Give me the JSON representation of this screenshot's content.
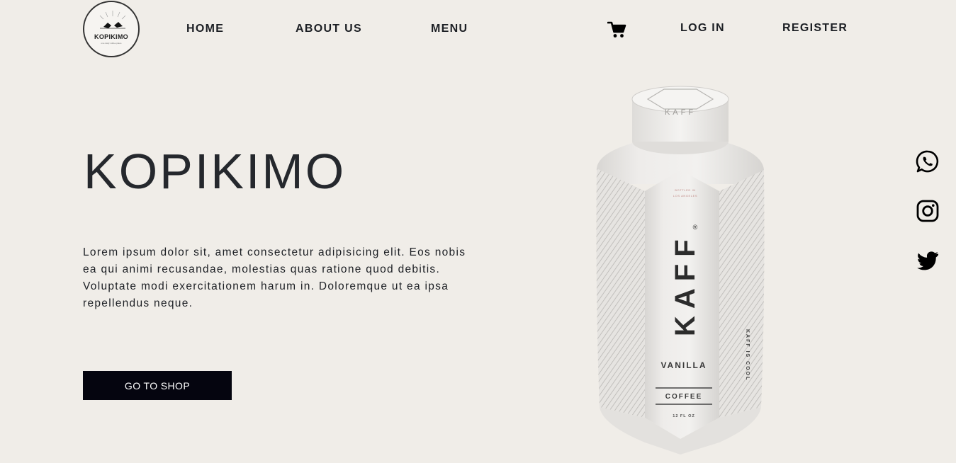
{
  "brand": {
    "logo_text": "KOPIKIMO",
    "logo_subtext": "one daily coffee place"
  },
  "nav": {
    "home": "HOME",
    "about": "ABOUT US",
    "menu": "MENU",
    "login": "LOG IN",
    "register": "REGISTER",
    "cart_icon": "shopping-cart-icon"
  },
  "hero": {
    "title": "KOPIKIMO",
    "description": "Lorem ipsum dolor sit, amet consectetur adipisicing elit. Eos nobis ea qui animi recusandae, molestias quas ratione quod debitis. Voluptate modi exercitationem harum in. Doloremque ut ea ipsa repellendus neque.",
    "cta_label": "GO TO SHOP"
  },
  "product": {
    "cap_text": "KAFF",
    "tagline_1": "BOTTLED IN",
    "tagline_2": "LOS ANGELES",
    "brand_vertical": "KAFF",
    "registered_mark": "®",
    "flavor": "VANILLA",
    "type": "COFFEE",
    "volume": "12 FL OZ",
    "side_text": "KAFF IS COOL"
  },
  "social": {
    "icons": [
      "whatsapp-icon",
      "instagram-icon",
      "twitter-icon"
    ]
  },
  "colors": {
    "background": "#f0ede8",
    "text": "#1c1f24",
    "button_bg": "#05050f",
    "button_text": "#ffffff"
  }
}
